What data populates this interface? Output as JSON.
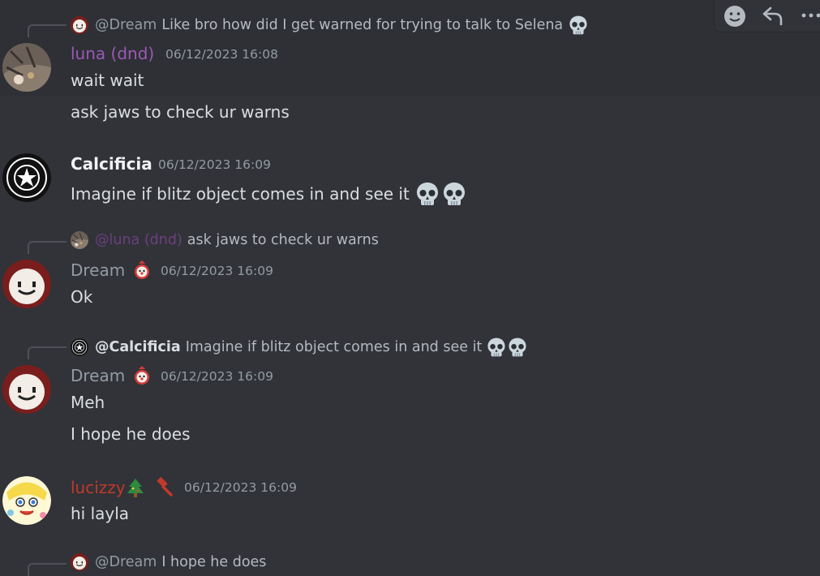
{
  "colors": {
    "bg": "#313338",
    "hover": "#2e3035",
    "luna": "#9b59b6",
    "lucizzy": "#c0392b",
    "dream": "#949ba4",
    "white": "#f2f3f5"
  },
  "toolbar": {
    "icons": [
      "add-reaction-icon",
      "reply-icon",
      "more-icon"
    ]
  },
  "messages": [
    {
      "reply": {
        "name": "@Dream",
        "text": "Like bro how did I get warned for trying to talk to Selena"
      },
      "author": "luna (dnd)",
      "time": "06/12/2023 16:08",
      "lines": [
        "wait wait",
        "ask jaws to check ur warns"
      ]
    },
    {
      "author": "Calcificia",
      "time": "06/12/2023 16:09",
      "lines": [
        "Imagine if blitz object comes in and see it"
      ]
    },
    {
      "reply": {
        "name": "@luna (dnd)",
        "text": "ask jaws to check ur warns"
      },
      "author": "Dream",
      "time": "06/12/2023 16:09",
      "lines": [
        "Ok"
      ]
    },
    {
      "reply": {
        "name": "@Calcificia",
        "text": "Imagine if blitz object comes in and see it"
      },
      "author": "Dream",
      "time": "06/12/2023 16:09",
      "lines": [
        "Meh",
        "I hope he does"
      ]
    },
    {
      "author": "lucizzy",
      "time": "06/12/2023 16:09",
      "lines": [
        "hi layla"
      ]
    },
    {
      "reply": {
        "name": "@Dream",
        "text": "I hope he does"
      }
    }
  ]
}
